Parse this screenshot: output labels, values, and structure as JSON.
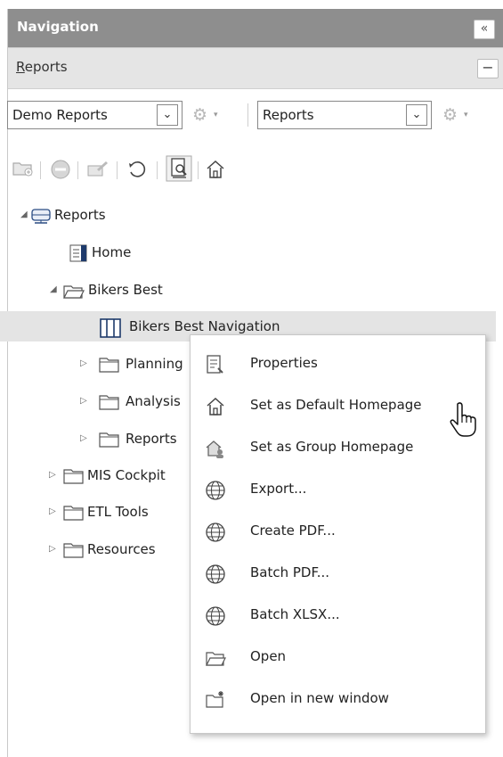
{
  "navigation": {
    "title": "Navigation",
    "collapse_glyph": "«"
  },
  "section": {
    "label_first_letter": "R",
    "label_rest": "eports",
    "minimize_glyph": "−"
  },
  "toolbar": {
    "left_select_value": "Demo Reports",
    "right_select_value": "Reports",
    "dropdown_glyph": "⌄",
    "gear_glyph": "⚙",
    "caret_glyph": "▾",
    "icons": [
      "new-folder-icon",
      "delete-icon",
      "edit-icon",
      "refresh-icon",
      "preview-icon",
      "home-icon"
    ]
  },
  "tree": [
    {
      "label": "Reports",
      "icon": "database-icon",
      "expanded": true
    },
    {
      "label": "Home",
      "icon": "report-icon"
    },
    {
      "label": "Bikers Best",
      "icon": "open-folder-icon",
      "expanded": true
    },
    {
      "label": "Bikers Best Navigation",
      "icon": "columns-icon",
      "selected": true
    },
    {
      "label": "Planning",
      "icon": "folder-icon",
      "expanded": false
    },
    {
      "label": "Analysis",
      "icon": "folder-icon",
      "expanded": false
    },
    {
      "label": "Reports",
      "icon": "folder-icon",
      "expanded": false
    },
    {
      "label": "MIS Cockpit",
      "icon": "folder-icon",
      "expanded": false
    },
    {
      "label": "ETL Tools",
      "icon": "folder-icon",
      "expanded": false
    },
    {
      "label": "Resources",
      "icon": "folder-icon",
      "expanded": false
    }
  ],
  "tree_glyphs": {
    "expanded": "◢",
    "collapsed": "▷"
  },
  "context_menu": [
    {
      "label": "Properties",
      "icon": "properties-icon"
    },
    {
      "label": "Set as Default Homepage",
      "icon": "home-icon"
    },
    {
      "label": "Set as Group Homepage",
      "icon": "group-home-icon"
    },
    {
      "label": "Export...",
      "icon": "globe-icon"
    },
    {
      "label": "Create PDF...",
      "icon": "globe-icon"
    },
    {
      "label": "Batch PDF...",
      "icon": "globe-icon"
    },
    {
      "label": "Batch XLSX...",
      "icon": "globe-icon"
    },
    {
      "label": "Open",
      "icon": "open-folder-icon"
    },
    {
      "label": "Open in new window",
      "icon": "new-window-icon"
    }
  ]
}
